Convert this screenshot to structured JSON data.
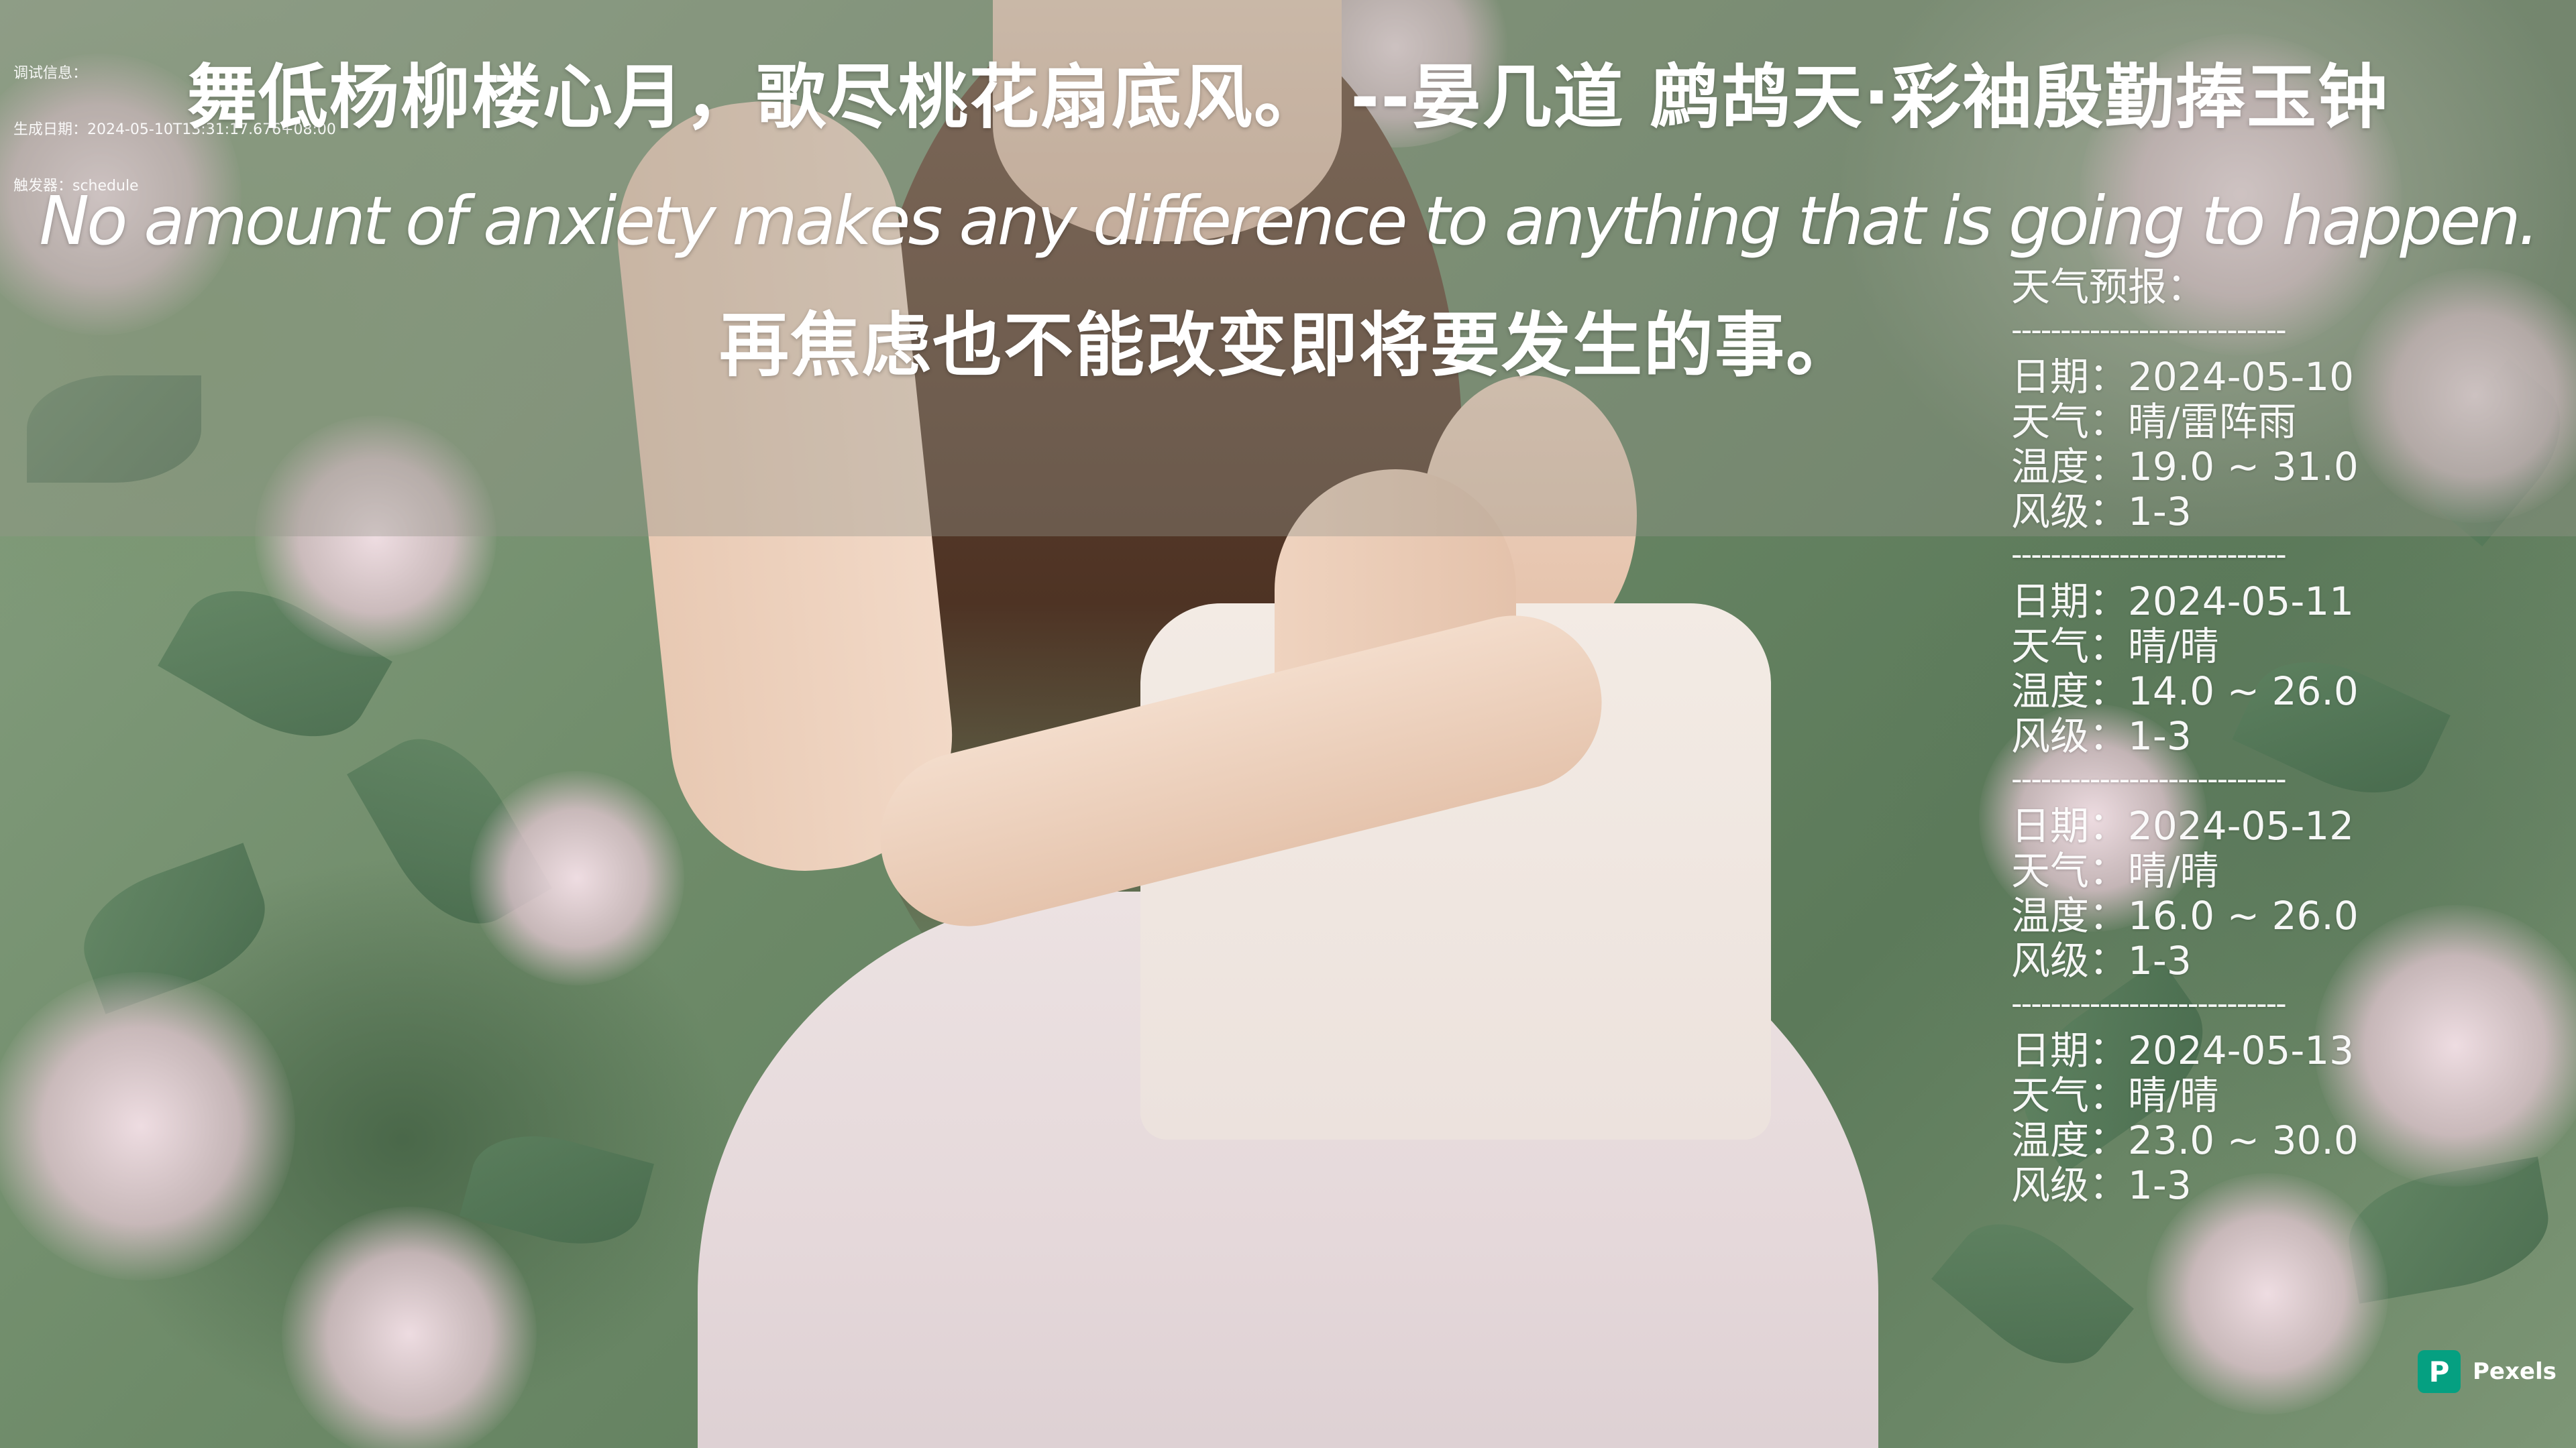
{
  "debug": {
    "line1": "调试信息：",
    "line2": "生成日期：2024-05-10T13:31:17.676+08:00",
    "line3": "触发器：schedule"
  },
  "poem": {
    "chinese_line": "舞低杨柳楼心月，歌尽桃花扇底风。  --晏几道 鹧鸪天·彩袖殷勤捧玉钟",
    "english_line": "No amount of anxiety makes any difference to anything that is going to happen.",
    "translation_line": "再焦虑也不能改变即将要发生的事。"
  },
  "weather": {
    "title": "天气预报：",
    "separator": "----------------------------",
    "days": [
      {
        "date": "日期：2024-05-10",
        "condition": "天气：晴/雷阵雨",
        "temperature": "温度：19.0 ~ 31.0",
        "wind": "风级：1-3"
      },
      {
        "date": "日期：2024-05-11",
        "condition": "天气：晴/晴",
        "temperature": "温度：14.0 ~ 26.0",
        "wind": "风级：1-3"
      },
      {
        "date": "日期：2024-05-12",
        "condition": "天气：晴/晴",
        "temperature": "温度：16.0 ~ 26.0",
        "wind": "风级：1-3"
      },
      {
        "date": "日期：2024-05-13",
        "condition": "天气：晴/晴",
        "temperature": "温度：23.0 ~ 30.0",
        "wind": "风级：1-3"
      }
    ]
  },
  "watermark": {
    "logo_letter": "P",
    "brand": "Pexels",
    "logo_color": "#05a081"
  }
}
